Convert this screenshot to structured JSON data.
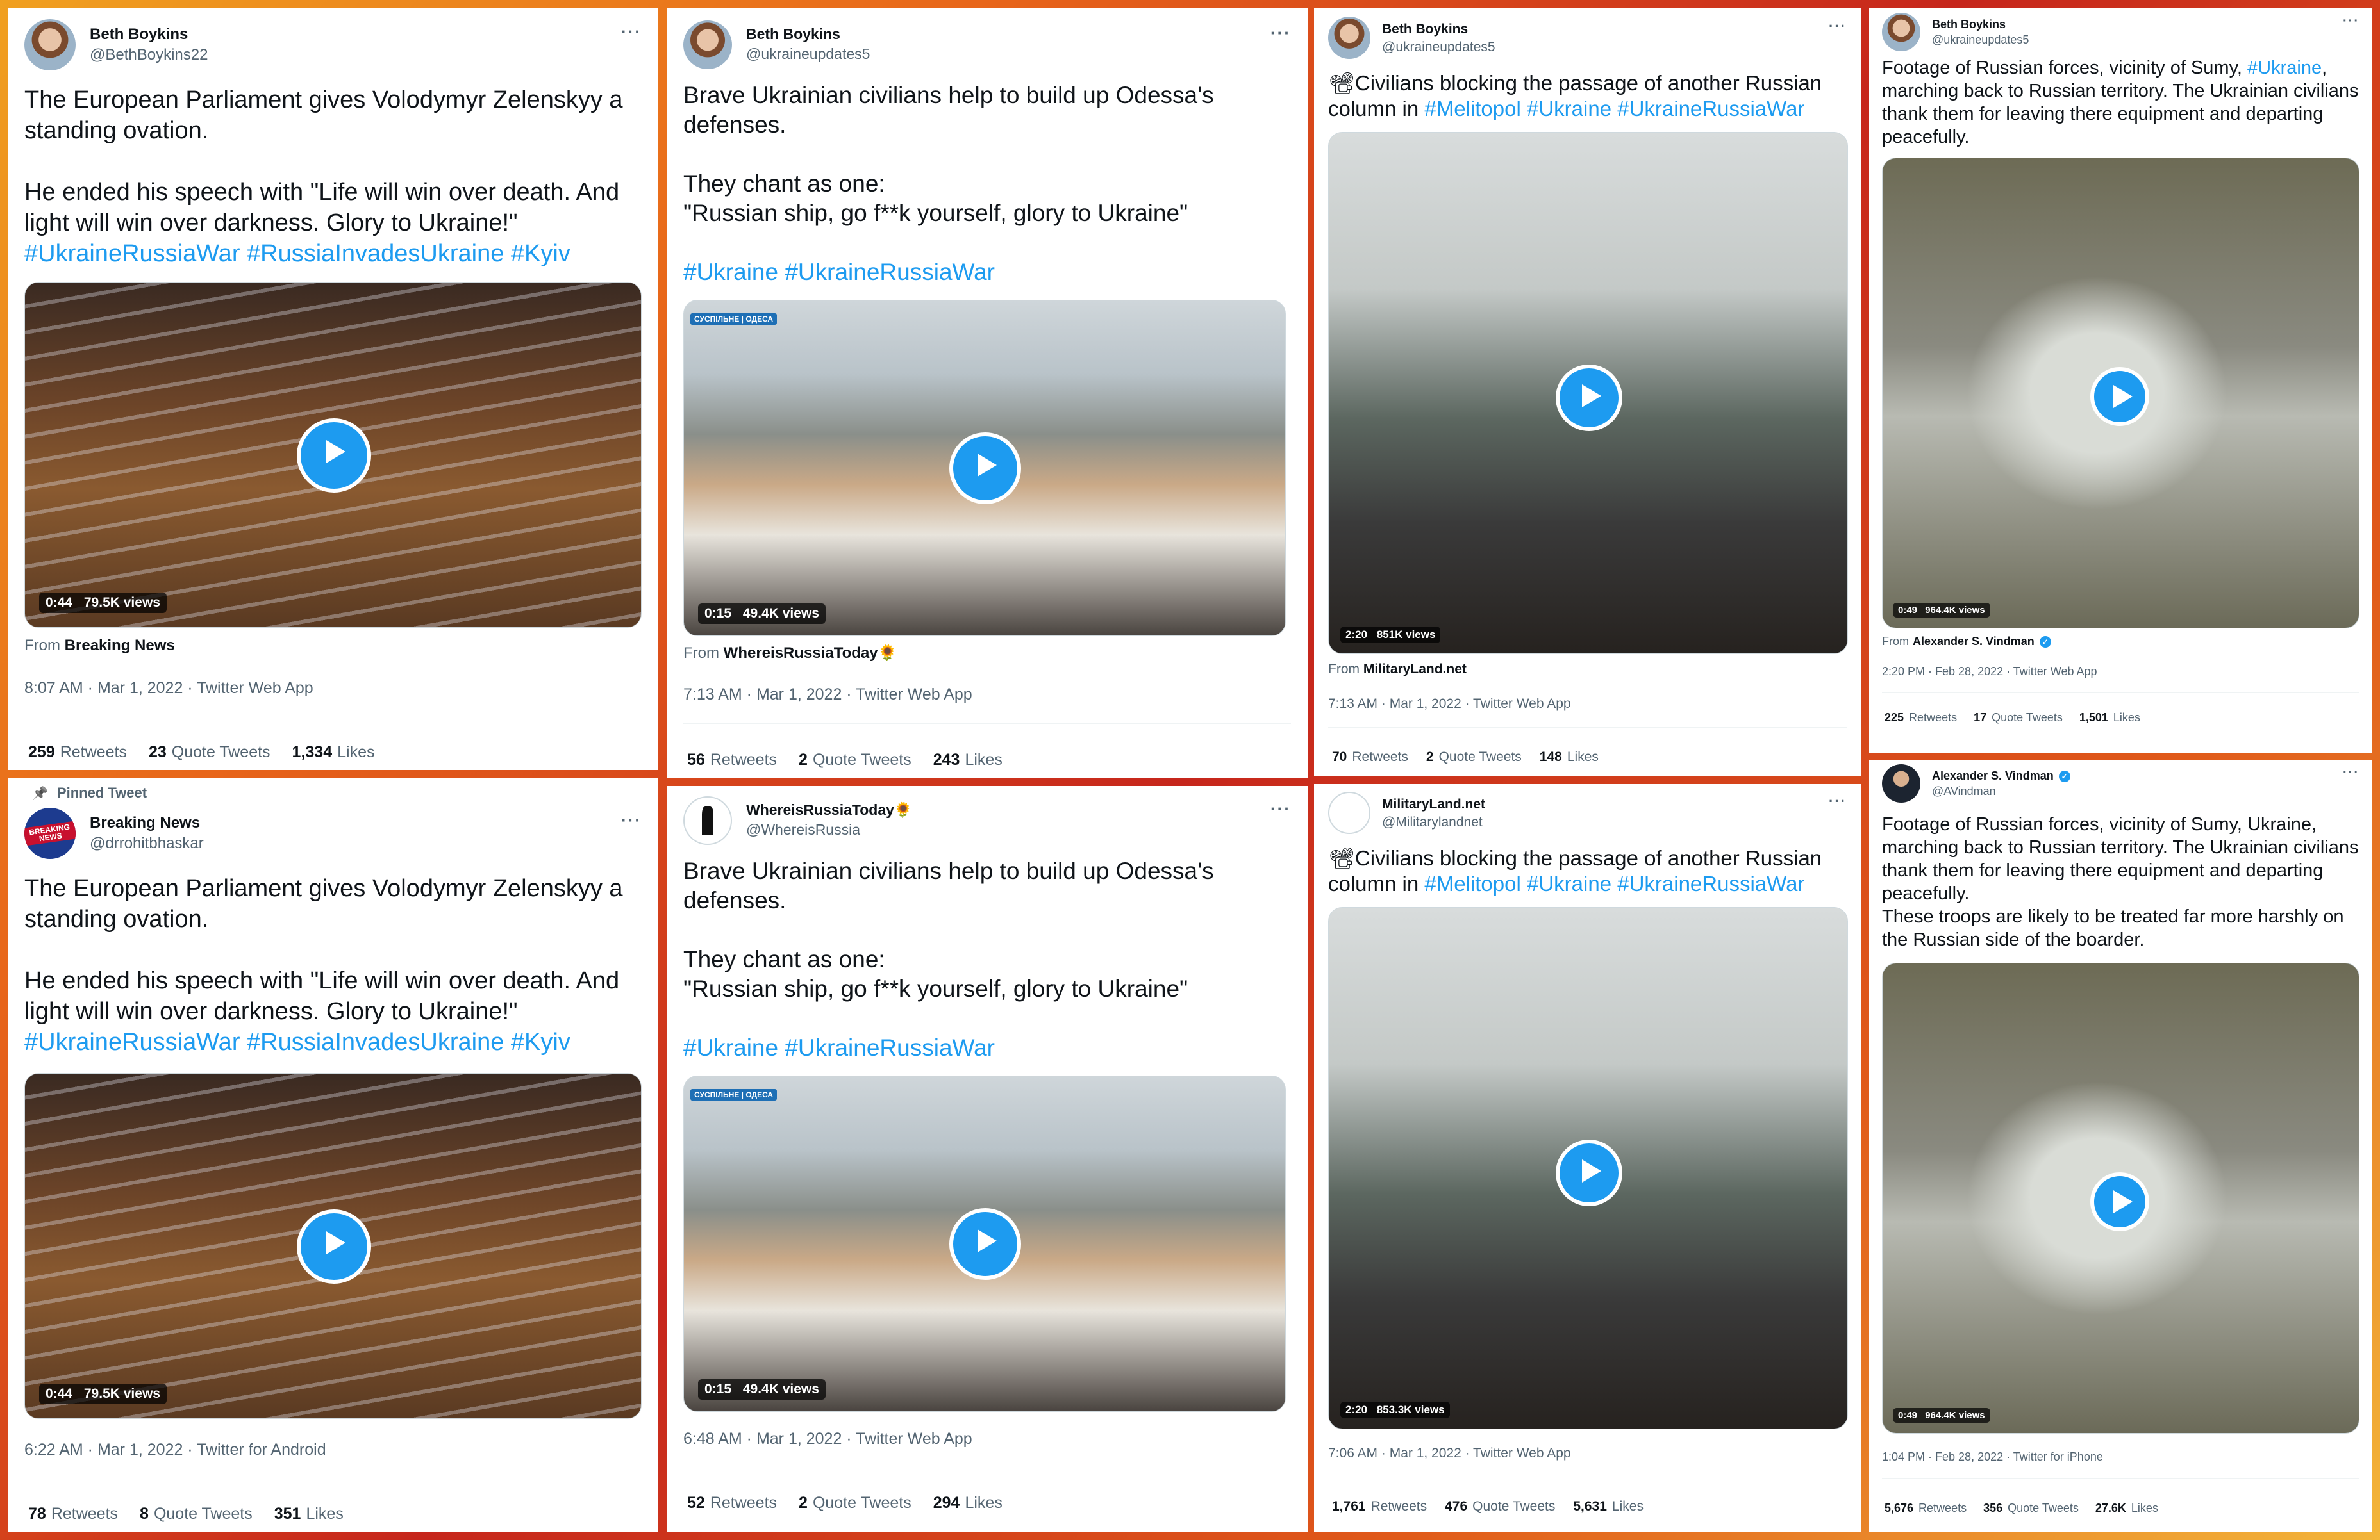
{
  "cards": [
    {
      "author": {
        "name": "Beth Boykins",
        "handle": "@BethBoykins22"
      },
      "text": "The European Parliament gives Volodymyr Zelenskyy a standing ovation.\n\nHe ended his speech with \"Life will win over death. And light will win over darkness. Glory to Ukraine!\"",
      "hashtags": "#UkraineRussiaWar #RussiaInvadesUkraine #Kyiv",
      "video": {
        "duration": "0:44",
        "views": "79.5K views"
      },
      "from_label": "From",
      "from_source": "Breaking News",
      "meta": "8:07 AM · Mar 1, 2022 · Twitter Web App",
      "stats": {
        "retweets": "259",
        "retweets_label": "Retweets",
        "quotes": "23",
        "quotes_label": "Quote Tweets",
        "likes": "1,334",
        "likes_label": "Likes"
      }
    },
    {
      "pinned": "Pinned Tweet",
      "author": {
        "name": "Breaking News",
        "handle": "@drrohitbhaskar",
        "avatar_text": "BREAKING NEWS"
      },
      "text": "The European Parliament gives Volodymyr Zelenskyy a standing ovation.\n\nHe ended his speech with \"Life will win over death. And light will win over darkness. Glory to Ukraine!\"",
      "hashtags": "#UkraineRussiaWar #RussiaInvadesUkraine #Kyiv",
      "video": {
        "duration": "0:44",
        "views": "79.5K views"
      },
      "meta": "6:22 AM · Mar 1, 2022 · Twitter for Android",
      "stats": {
        "retweets": "78",
        "retweets_label": "Retweets",
        "quotes": "8",
        "quotes_label": "Quote Tweets",
        "likes": "351",
        "likes_label": "Likes"
      }
    },
    {
      "author": {
        "name": "Beth Boykins",
        "handle": "@ukraineupdates5"
      },
      "text": "Brave Ukrainian civilians help to build up Odessa's defenses.\n\nThey chant as one:\n\"Russian ship, go f**k yourself, glory to Ukraine\"",
      "hashtags": "#Ukraine #UkraineRussiaWar",
      "video": {
        "duration": "0:15",
        "views": "49.4K views",
        "channel": "СУСПІЛЬНЕ | ОДЕСА"
      },
      "from_label": "From",
      "from_source": "WhereisRussiaToday🌻",
      "meta": "7:13 AM · Mar 1, 2022 · Twitter Web App",
      "stats": {
        "retweets": "56",
        "retweets_label": "Retweets",
        "quotes": "2",
        "quotes_label": "Quote Tweets",
        "likes": "243",
        "likes_label": "Likes"
      }
    },
    {
      "author": {
        "name": "WhereisRussiaToday🌻",
        "handle": "@WhereisRussia"
      },
      "text": "Brave Ukrainian civilians help to build up Odessa's defenses.\n\nThey chant as one:\n\"Russian ship, go f**k yourself, glory to Ukraine\"",
      "hashtags": "#Ukraine #UkraineRussiaWar",
      "video": {
        "duration": "0:15",
        "views": "49.4K views",
        "channel": "СУСПІЛЬНЕ | ОДЕСА"
      },
      "meta": "6:48 AM · Mar 1, 2022 · Twitter Web App",
      "stats": {
        "retweets": "52",
        "retweets_label": "Retweets",
        "quotes": "2",
        "quotes_label": "Quote Tweets",
        "likes": "294",
        "likes_label": "Likes"
      }
    },
    {
      "author": {
        "name": "Beth Boykins",
        "handle": "@ukraineupdates5"
      },
      "text_prefix": "📽Civilians blocking the passage of another Russian column in ",
      "hashtags": "#Melitopol #Ukraine #UkraineRussiaWar",
      "video": {
        "duration": "2:20",
        "views": "851K views"
      },
      "from_label": "From",
      "from_source": "MilitaryLand.net",
      "meta": "7:13 AM · Mar 1, 2022 · Twitter Web App",
      "stats": {
        "retweets": "70",
        "retweets_label": "Retweets",
        "quotes": "2",
        "quotes_label": "Quote Tweets",
        "likes": "148",
        "likes_label": "Likes"
      }
    },
    {
      "author": {
        "name": "MilitaryLand.net",
        "handle": "@Militarylandnet"
      },
      "text_prefix": "📽Civilians blocking the passage of another Russian column in ",
      "hashtags": "#Melitopol #Ukraine #UkraineRussiaWar",
      "video": {
        "duration": "2:20",
        "views": "853.3K views"
      },
      "meta": "7:06 AM · Mar 1, 2022 · Twitter Web App",
      "stats": {
        "retweets": "1,761",
        "retweets_label": "Retweets",
        "quotes": "476",
        "quotes_label": "Quote Tweets",
        "likes": "5,631",
        "likes_label": "Likes"
      }
    },
    {
      "author": {
        "name": "Beth Boykins",
        "handle": "@ukraineupdates5"
      },
      "text_prefix": "Footage of Russian forces, vicinity of Sumy, ",
      "text_tag": "#Ukraine",
      "text_suffix": ", marching back to Russian territory. The Ukrainian civilians thank them for leaving there equipment and departing peacefully.",
      "video": {
        "duration": "0:49",
        "views": "964.4K views"
      },
      "from_label": "From",
      "from_source": "Alexander S. Vindman",
      "meta": "2:20 PM · Feb 28, 2022 · Twitter Web App",
      "stats": {
        "retweets": "225",
        "retweets_label": "Retweets",
        "quotes": "17",
        "quotes_label": "Quote Tweets",
        "likes": "1,501",
        "likes_label": "Likes"
      }
    },
    {
      "author": {
        "name": "Alexander S. Vindman",
        "handle": "@AVindman"
      },
      "text": "Footage of Russian forces, vicinity of Sumy, Ukraine, marching back to Russian territory. The Ukrainian civilians thank them for leaving there equipment and departing peacefully.\nThese troops are likely to be treated far more harshly on the Russian side of the boarder.",
      "video": {
        "duration": "0:49",
        "views": "964.4K views"
      },
      "meta": "1:04 PM · Feb 28, 2022 · Twitter for iPhone",
      "stats": {
        "retweets": "5,676",
        "retweets_label": "Retweets",
        "quotes": "356",
        "quotes_label": "Quote Tweets",
        "likes": "27.6K",
        "likes_label": "Likes"
      }
    }
  ],
  "ui": {
    "more": "···",
    "verified": "✓",
    "pin": "📌"
  }
}
